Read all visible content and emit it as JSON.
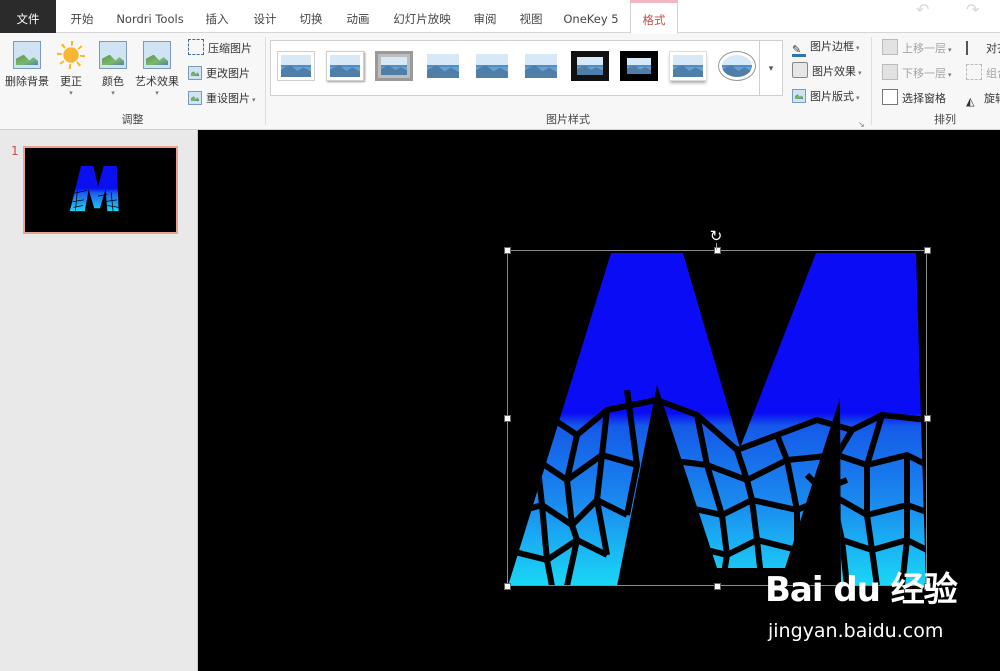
{
  "tabs": [
    {
      "label": "文件",
      "state": "file"
    },
    {
      "label": "开始",
      "state": "normal"
    },
    {
      "label": "Nordri Tools",
      "state": "normal"
    },
    {
      "label": "插入",
      "state": "normal"
    },
    {
      "label": "设计",
      "state": "normal"
    },
    {
      "label": "切换",
      "state": "normal"
    },
    {
      "label": "动画",
      "state": "normal"
    },
    {
      "label": "幻灯片放映",
      "state": "normal"
    },
    {
      "label": "审阅",
      "state": "normal"
    },
    {
      "label": "视图",
      "state": "normal"
    },
    {
      "label": "OneKey 5",
      "state": "normal"
    },
    {
      "label": "格式",
      "state": "active"
    }
  ],
  "ribbon": {
    "adjust": {
      "remove_bg": "删除背景",
      "corrections": "更正",
      "color": "颜色",
      "artistic": "艺术效果",
      "compress": "压缩图片",
      "change": "更改图片",
      "reset": "重设图片",
      "label": "调整"
    },
    "styles": {
      "label": "图片样式",
      "border": "图片边框",
      "effects": "图片效果",
      "layout": "图片版式"
    },
    "arrange": {
      "label": "排列",
      "bring_forward": "上移一层",
      "send_backward": "下移一层",
      "selection_pane": "选择窗格",
      "align": "对齐",
      "group": "组合",
      "rotate": "旋转"
    }
  },
  "slides": [
    {
      "number": "1"
    }
  ],
  "watermark": {
    "logo": "Bai du 经验",
    "url": "jingyan.baidu.com"
  },
  "colors": {
    "accent": "#c0504d",
    "letter_top": "#0a10f0",
    "letter_bottom": "#1ad6f5"
  }
}
